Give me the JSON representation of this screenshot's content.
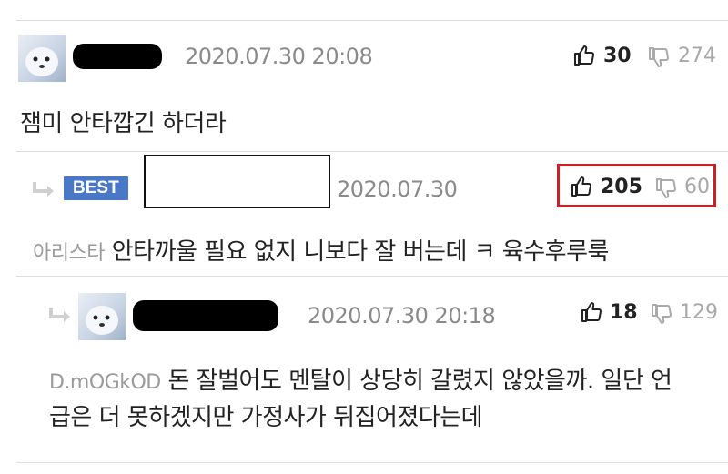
{
  "comments": [
    {
      "date": "2020.07.30 20:08",
      "text": "잼미 안타깝긴 하더라",
      "upvotes": "30",
      "downvotes": "274"
    },
    {
      "badge": "BEST",
      "date": "2020.07.30",
      "nickname": "아리스타",
      "text": "안타까울 필요 없지 니보다 잘 버는데 ㅋ 육수후루룩",
      "upvotes": "205",
      "downvotes": "60"
    },
    {
      "date": "2020.07.30 20:18",
      "nickname": "D.mOGkOD",
      "text_line1": "돈 잘벌어도 멘탈이 상당히 갈렸지 않았을까. 일단 언",
      "text_line2": "급은 더 못하겠지만 가정사가 뒤집어졌다는데",
      "upvotes": "18",
      "downvotes": "129"
    }
  ],
  "colors": {
    "best_badge": "#4a78c9",
    "highlight": "#cc2027"
  },
  "icons": {
    "up": "thumbs-up-icon",
    "down": "thumbs-down-icon",
    "reply": "reply-arrow-icon"
  }
}
